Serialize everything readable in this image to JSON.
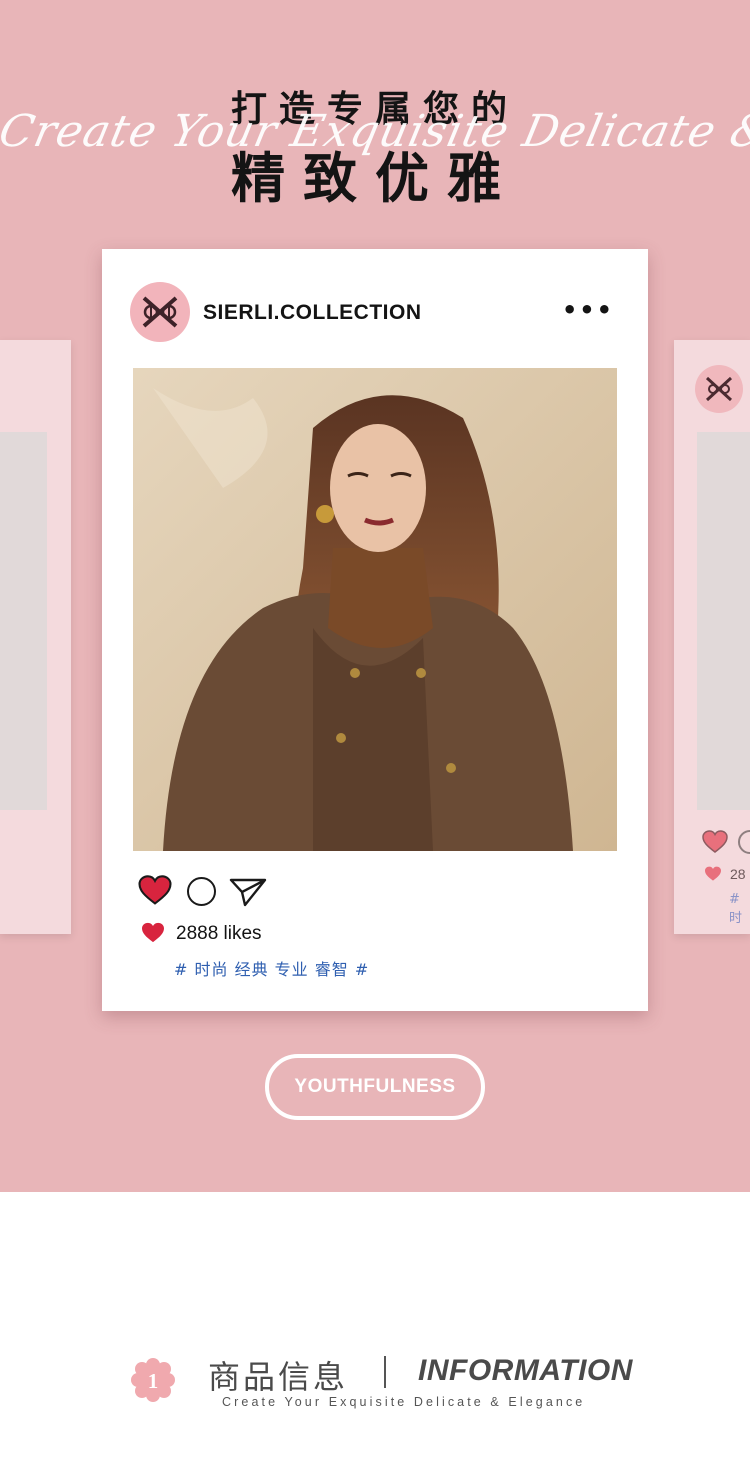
{
  "hero": {
    "title_line1": "打造专属您的",
    "title_script": "Create Your Exquisite Delicate & Elegance",
    "title_line2": "精致优雅",
    "background_color": "#e8b5b8"
  },
  "post": {
    "username": "SIERLI.COLLECTION",
    "more_label": "•••",
    "likes_text": "2888 likes",
    "tags": "# 时尚 经典 专业 睿智 #",
    "icons": {
      "avatar": "brand-logo-icon",
      "like": "heart-icon",
      "comment": "comment-circle-icon",
      "share": "send-icon",
      "likes": "small-heart-icon",
      "more": "more-dots-icon"
    }
  },
  "side_card_right": {
    "likes_fragment": "28",
    "tag_fragment": "# 时"
  },
  "pill": {
    "label": "YOUTHFULNESS"
  },
  "info": {
    "number": "1",
    "title_cn": "商品信息",
    "separator": "|",
    "title_en": "INFORMATION",
    "subtitle": "Create Your Exquisite Delicate & Elegance"
  },
  "colors": {
    "accent_pink": "#e8b5b8",
    "heart_red": "#d8243e",
    "tag_blue": "#2f5fb0"
  }
}
